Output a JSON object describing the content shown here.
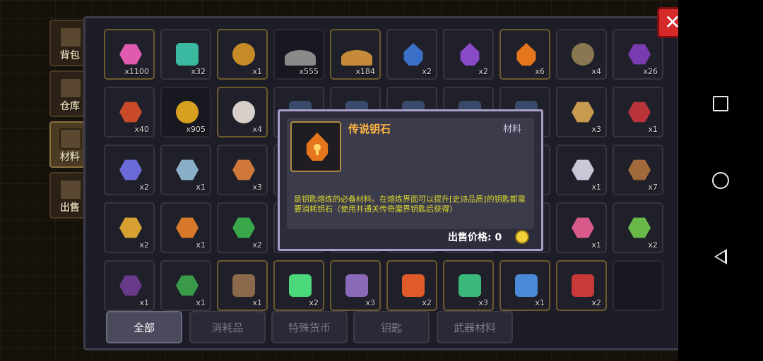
{
  "side_tabs": [
    {
      "label": "背包",
      "active": false
    },
    {
      "label": "仓库",
      "active": false
    },
    {
      "label": "材料",
      "active": true
    },
    {
      "label": "出售",
      "active": false
    }
  ],
  "close_button": {
    "icon": "close-icon",
    "glyph": "✕"
  },
  "items": [
    [
      {
        "icon": "pink-gem-icon",
        "color": "#e05bb0",
        "shape": "hexa",
        "qty": "x1100",
        "frame": "gold"
      },
      {
        "icon": "teal-chip-icon",
        "color": "#3ab9a0",
        "shape": "square",
        "qty": "x32",
        "frame": "normal"
      },
      {
        "icon": "gold-coin-c-icon",
        "color": "#c88a26",
        "shape": "round",
        "qty": "x1",
        "frame": "gold"
      },
      {
        "icon": "gray-rock-icon",
        "color": "#8a8a8a",
        "shape": "rock",
        "qty": "x555",
        "frame": "dark"
      },
      {
        "icon": "gold-ore-pile-icon",
        "color": "#c68a3a",
        "shape": "rock",
        "qty": "x184",
        "frame": "gold"
      },
      {
        "icon": "blue-key-stone-icon",
        "color": "#3a70c8",
        "shape": "drop",
        "qty": "x2",
        "frame": "normal"
      },
      {
        "icon": "purple-key-stone-icon",
        "color": "#8a4ac8",
        "shape": "drop",
        "qty": "x2",
        "frame": "normal"
      },
      {
        "icon": "orange-key-stone-icon",
        "color": "#e6761c",
        "shape": "drop",
        "qty": "x6",
        "frame": "gold"
      },
      {
        "icon": "bronze-medal-icon",
        "color": "#8a7650",
        "shape": "round",
        "qty": "x4",
        "frame": "normal"
      },
      {
        "icon": "purple-box-icon",
        "color": "#7a3ab0",
        "shape": "hexa",
        "qty": "x26",
        "frame": "normal"
      }
    ],
    [
      {
        "icon": "red-badge-icon",
        "color": "#c84a2a",
        "shape": "hexa",
        "qty": "x40",
        "frame": "normal"
      },
      {
        "icon": "gold-medal-ribbon-icon",
        "color": "#d8a020",
        "shape": "round",
        "qty": "x905",
        "frame": "dark"
      },
      {
        "icon": "skull-potion-icon",
        "color": "#d8d0c8",
        "shape": "round",
        "qty": "x4",
        "frame": "gold"
      },
      {
        "icon": "blue-part-icon",
        "color": "#3a4a6a",
        "shape": "square",
        "qty": "",
        "frame": "normal"
      },
      {
        "icon": "blue-part-icon",
        "color": "#3a4a6a",
        "shape": "square",
        "qty": "",
        "frame": "normal"
      },
      {
        "icon": "blue-part-icon",
        "color": "#3a4a6a",
        "shape": "square",
        "qty": "",
        "frame": "normal"
      },
      {
        "icon": "blue-part-icon",
        "color": "#3a4a6a",
        "shape": "square",
        "qty": "",
        "frame": "normal"
      },
      {
        "icon": "blue-part-icon",
        "color": "#3a4a6a",
        "shape": "square",
        "qty": "",
        "frame": "normal"
      },
      {
        "icon": "brass-key-icon",
        "color": "#c89a50",
        "shape": "hexa",
        "qty": "x3",
        "frame": "normal"
      },
      {
        "icon": "red-quill-icon",
        "color": "#b8343a",
        "shape": "hexa",
        "qty": "x1",
        "frame": "normal"
      }
    ],
    [
      {
        "icon": "blue-vial-icon",
        "color": "#6a6ad8",
        "shape": "hexa",
        "qty": "x2",
        "frame": "normal"
      },
      {
        "icon": "steel-coil-icon",
        "color": "#8ab0c8",
        "shape": "hexa",
        "qty": "x1",
        "frame": "normal"
      },
      {
        "icon": "orange-brick-icon",
        "color": "#d0783a",
        "shape": "hexa",
        "qty": "x3",
        "frame": "normal"
      },
      {
        "icon": "hidden-icon",
        "color": "#3a3a4a",
        "shape": "square",
        "qty": "",
        "frame": "normal"
      },
      {
        "icon": "hidden-icon",
        "color": "#3a3a4a",
        "shape": "square",
        "qty": "",
        "frame": "normal"
      },
      {
        "icon": "hidden-icon",
        "color": "#3a3a4a",
        "shape": "square",
        "qty": "",
        "frame": "normal"
      },
      {
        "icon": "hidden-icon",
        "color": "#3a3a4a",
        "shape": "square",
        "qty": "",
        "frame": "normal"
      },
      {
        "icon": "hidden-icon",
        "color": "#3a3a4a",
        "shape": "square",
        "qty": "",
        "frame": "normal"
      },
      {
        "icon": "boomerang-icon",
        "color": "#c8c8d8",
        "shape": "hexa",
        "qty": "x1",
        "frame": "normal"
      },
      {
        "icon": "brown-stick-icon",
        "color": "#a06a3a",
        "shape": "hexa",
        "qty": "x7",
        "frame": "normal"
      }
    ],
    [
      {
        "icon": "purple-wrench-icon",
        "color": "#d8a030",
        "shape": "hexa",
        "qty": "x2",
        "frame": "normal"
      },
      {
        "icon": "orange-ring-icon",
        "color": "#d8782a",
        "shape": "hexa",
        "qty": "x1",
        "frame": "normal"
      },
      {
        "icon": "green-orb-icon",
        "color": "#3aa84a",
        "shape": "hexa",
        "qty": "x2",
        "frame": "normal"
      },
      {
        "icon": "hidden-icon",
        "color": "#3a3a4a",
        "shape": "square",
        "qty": "",
        "frame": "normal"
      },
      {
        "icon": "hidden-icon",
        "color": "#3a3a4a",
        "shape": "square",
        "qty": "",
        "frame": "normal"
      },
      {
        "icon": "hidden-icon",
        "color": "#3a3a4a",
        "shape": "square",
        "qty": "",
        "frame": "normal"
      },
      {
        "icon": "hidden-icon",
        "color": "#3a3a4a",
        "shape": "square",
        "qty": "",
        "frame": "normal"
      },
      {
        "icon": "hidden-icon",
        "color": "#3a3a4a",
        "shape": "square",
        "qty": "",
        "frame": "normal"
      },
      {
        "icon": "pink-crab-icon",
        "color": "#d85a8a",
        "shape": "hexa",
        "qty": "x1",
        "frame": "normal"
      },
      {
        "icon": "green-comb-icon",
        "color": "#6ab84a",
        "shape": "hexa",
        "qty": "x2",
        "frame": "normal"
      }
    ],
    [
      {
        "icon": "purple-claw-icon",
        "color": "#6a3a8a",
        "shape": "hexa",
        "qty": "x1",
        "frame": "normal"
      },
      {
        "icon": "green-plant-icon",
        "color": "#3a9a4a",
        "shape": "hexa",
        "qty": "x1",
        "frame": "normal"
      },
      {
        "icon": "crossed-sticks-icon",
        "color": "#8a6a4a",
        "shape": "square",
        "qty": "x1",
        "frame": "gold"
      },
      {
        "icon": "green-crystal-icon",
        "color": "#4ad87a",
        "shape": "square",
        "qty": "x2",
        "frame": "gold"
      },
      {
        "icon": "pickaxe-icon",
        "color": "#8a6ab8",
        "shape": "square",
        "qty": "x3",
        "frame": "gold"
      },
      {
        "icon": "orange-flower-icon",
        "color": "#e05a2a",
        "shape": "square",
        "qty": "x2",
        "frame": "gold"
      },
      {
        "icon": "green-sock-icon",
        "color": "#3ab87a",
        "shape": "square",
        "qty": "x3",
        "frame": "gold"
      },
      {
        "icon": "blue-cloak-icon",
        "color": "#4a8ad8",
        "shape": "square",
        "qty": "x1",
        "frame": "gold"
      },
      {
        "icon": "red-flower-icon",
        "color": "#c83a3a",
        "shape": "square",
        "qty": "x2",
        "frame": "gold"
      },
      {
        "icon": "empty-slot",
        "color": "#1f2029",
        "shape": "square",
        "qty": "",
        "frame": "dark"
      }
    ]
  ],
  "bottom_tabs": [
    {
      "label": "全部",
      "active": true
    },
    {
      "label": "消耗品",
      "active": false
    },
    {
      "label": "特殊货币",
      "active": false
    },
    {
      "label": "钥匙",
      "active": false
    },
    {
      "label": "武器材料",
      "active": false
    }
  ],
  "popup": {
    "icon": "legendary-key-stone-icon",
    "name": "传说钥石",
    "type": "材料",
    "description": "是钥匙熔炼的必备材料。在熔炼界面可以提升[史诗品质]的钥匙都需要消耗钥石（使用并通关传奇魔界钥匙后获得）",
    "price_label": "出售价格: 0",
    "coin_icon": "gold-coin-icon",
    "name_color": "#ffb640",
    "desc_color": "#dcd92c"
  },
  "system_nav": [
    {
      "icon": "recent-apps-icon"
    },
    {
      "icon": "home-icon"
    },
    {
      "icon": "back-icon"
    }
  ]
}
